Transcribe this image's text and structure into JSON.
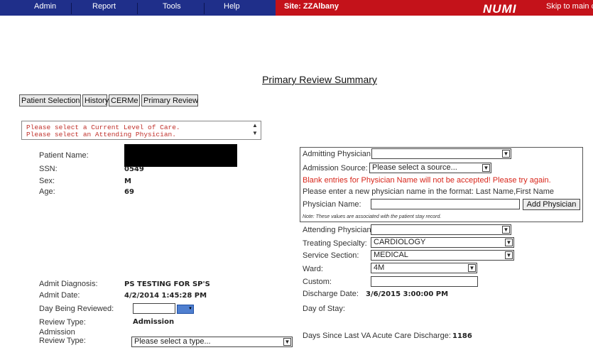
{
  "nav": {
    "items": [
      "Admin",
      "Report",
      "Tools",
      "Help"
    ],
    "site": "Site: ZZAlbany",
    "logo": "NUMI",
    "skip": "Skip to main c"
  },
  "title": "Primary Review Summary",
  "tabs": [
    "Patient Selection",
    "History",
    "CERMe",
    "Primary Review"
  ],
  "messages": [
    "Please select a Current Level of Care.",
    "Please select an Attending Physician."
  ],
  "patient": {
    "name_label": "Patient Name:",
    "ssn_label": "SSN:",
    "ssn_value": "0549",
    "sex_label": "Sex:",
    "sex_value": "M",
    "age_label": "Age:",
    "age_value": "69"
  },
  "physician_group": {
    "admitting_label": "Admitting Physician:",
    "admitting_value": "",
    "source_label": "Admission Source:",
    "source_value": "Please select a source...",
    "warning": "Blank entries for Physician Name will not be accepted! Please try again.",
    "instruction": "Please enter a new physician name in the format: Last Name,First Name",
    "name_label": "Physician Name:",
    "name_value": "",
    "add_button": "Add Physician",
    "note": "Note: These values are associated with the patient stay record."
  },
  "stay": {
    "attending_label": "Attending Physician:",
    "attending_value": "",
    "specialty_label": "Treating Specialty:",
    "specialty_value": "CARDIOLOGY",
    "service_label": "Service Section:",
    "service_value": "MEDICAL",
    "ward_label": "Ward:",
    "ward_value": "4M",
    "custom_label": "Custom:",
    "custom_value": "",
    "discharge_label": "Discharge Date:",
    "discharge_value": "3/6/2015 3:00:00 PM",
    "day_of_stay_label": "Day of Stay:",
    "days_since_label": "Days Since Last VA Acute Care Discharge:",
    "days_since_value": "1186"
  },
  "admit": {
    "diagnosis_label": "Admit Diagnosis:",
    "diagnosis_value": "PS TESTING FOR SP'S",
    "date_label": "Admit Date:",
    "date_value": "4/2/2014 1:45:28 PM",
    "day_reviewed_label": "Day Being Reviewed:",
    "day_reviewed_value": "",
    "review_type_label": "Review Type:",
    "review_type_value": "Admission",
    "admission_review_label_1": "Admission",
    "admission_review_label_2": "Review Type:",
    "admission_review_value": "Please select a type..."
  }
}
